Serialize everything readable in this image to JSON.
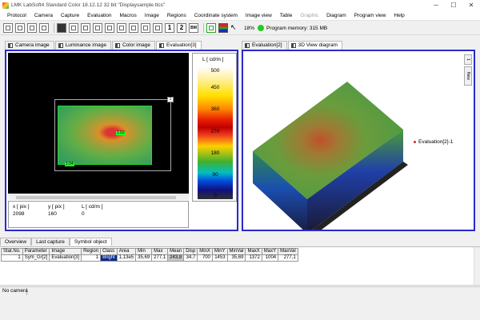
{
  "window": {
    "title": "LMK LabSoft4 Standard Color  18.12.12 32 bit  \"Displaysample.ttcs\"",
    "minimize": "─",
    "maximize": "☐",
    "close": "✕"
  },
  "menu": {
    "items": [
      "Protocol",
      "Camera",
      "Capture",
      "Evaluation",
      "Macros",
      "Image",
      "Regions",
      "Coordinate system",
      "Image view",
      "Table",
      "Graphic",
      "Diagram",
      "Program view",
      "Help"
    ],
    "disabled": [
      "Graphic"
    ]
  },
  "toolbar": {
    "num1": "1",
    "num2": "2",
    "bm": "BM",
    "zoom": "18%",
    "memory": "Program memory: 315 MB",
    "memory_color": "#22cc22"
  },
  "left_tabs": [
    "Camera image",
    "Luminance image",
    "Color image",
    "Evaluation[3]"
  ],
  "left_active_tab": "Evaluation[3]",
  "right_tabs": [
    "Evaluation[2]",
    "3D View diagram"
  ],
  "image": {
    "roi_label": "1",
    "marker_center": "1.02",
    "marker_corner": "1.04"
  },
  "colorbar": {
    "unit": "L  [  cd/m  ]",
    "ticks": [
      "500",
      "450",
      "360",
      "270",
      "180",
      "90",
      "0"
    ]
  },
  "pixel_info": {
    "headers": [
      "x  [ pix ]",
      "y  [ pix ]",
      "L  [ cd/m ]"
    ],
    "values": [
      "2098",
      "160",
      "0"
    ]
  },
  "plot3d": {
    "legend": "Evaluation[2]-1",
    "legend_color": "#dd2222"
  },
  "side_buttons": [
    "1",
    "New"
  ],
  "bottom_tabs": [
    "Overview",
    "Last capture",
    "Symbol object"
  ],
  "bottom_active_tab": "Symbol object",
  "table": {
    "headers": [
      "Stat.No.",
      "Parameter",
      "Image",
      "Region",
      "Class",
      "Area",
      "Min",
      "Max",
      "Mean",
      "Disp",
      "MinX",
      "MinY",
      "MinVal",
      "MaxX",
      "MaxY",
      "MaxVal"
    ],
    "rows": [
      [
        "1",
        "Sym_Gr[2]",
        "Evaluation[3]",
        "1",
        "Bright",
        "1,13e5",
        "35,69",
        "277,1",
        "243,8",
        "34,7",
        "700",
        "1453",
        "35,69",
        "1372",
        "1004",
        "277,1"
      ]
    ]
  },
  "status": {
    "camera": "No camera"
  }
}
